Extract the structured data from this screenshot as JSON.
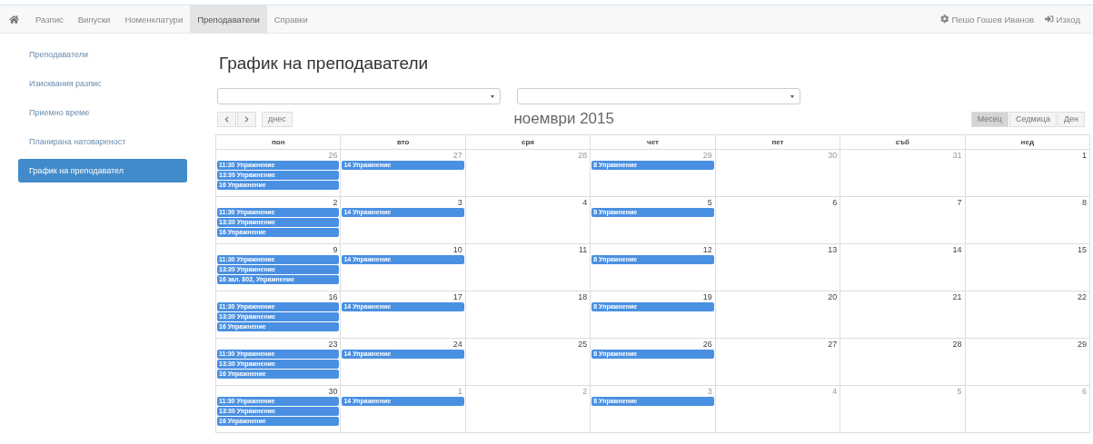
{
  "navbar": {
    "items": [
      {
        "label": "Разпис",
        "selected": false
      },
      {
        "label": "Випуски",
        "selected": false
      },
      {
        "label": "Номенклатури",
        "selected": false
      },
      {
        "label": "Преподаватели",
        "selected": true
      },
      {
        "label": "Справки",
        "selected": false
      }
    ],
    "user": "Пешо Гошев Иванов",
    "logout": "Изход"
  },
  "sidebar": {
    "items": [
      {
        "label": "Преподаватели",
        "selected": false
      },
      {
        "label": "Изисквания разпис",
        "selected": false
      },
      {
        "label": "Приемно време",
        "selected": false
      },
      {
        "label": "Планирана натовареност",
        "selected": false
      },
      {
        "label": "График на преподавател",
        "selected": true
      }
    ]
  },
  "page_title": "График на преподаватели",
  "toolbar": {
    "today": "днес",
    "month_title": "ноември 2015",
    "views": [
      {
        "label": "Месец",
        "selected": true
      },
      {
        "label": "Седмица",
        "selected": false
      },
      {
        "label": "Ден",
        "selected": false
      }
    ]
  },
  "calendar": {
    "weekdays": [
      "пон",
      "вто",
      "сря",
      "чет",
      "пет",
      "съб",
      "нед"
    ],
    "weeks": [
      [
        {
          "day": "26",
          "other_month": true,
          "events": [
            "11:30 Упражнение",
            "13:30 Упражнение",
            "16 Упражнение"
          ]
        },
        {
          "day": "27",
          "other_month": true,
          "events": [
            "14 Упражнение"
          ]
        },
        {
          "day": "28",
          "other_month": true
        },
        {
          "day": "29",
          "other_month": true,
          "events": [
            "8 Упражнение"
          ]
        },
        {
          "day": "30",
          "other_month": true
        },
        {
          "day": "31",
          "other_month": true
        },
        {
          "day": "1",
          "other_month": false
        }
      ],
      [
        {
          "day": "2",
          "other_month": false,
          "events": [
            "11:30 Упражнение",
            "13:30 Упражнение",
            "16 Упражнение"
          ]
        },
        {
          "day": "3",
          "other_month": false,
          "events": [
            "14 Упражнение"
          ]
        },
        {
          "day": "4",
          "other_month": false
        },
        {
          "day": "5",
          "other_month": false,
          "events": [
            "8 Упражнение"
          ]
        },
        {
          "day": "6",
          "other_month": false
        },
        {
          "day": "7",
          "other_month": false
        },
        {
          "day": "8",
          "other_month": false
        }
      ],
      [
        {
          "day": "9",
          "other_month": false,
          "events": [
            "11:30 Упражнение",
            "13:30 Упражнение",
            "16 зал. 802, Упражнение"
          ]
        },
        {
          "day": "10",
          "other_month": false,
          "events": [
            "14 Упражнение"
          ]
        },
        {
          "day": "11",
          "other_month": false
        },
        {
          "day": "12",
          "other_month": false,
          "events": [
            "8 Упражнение"
          ]
        },
        {
          "day": "13",
          "other_month": false
        },
        {
          "day": "14",
          "other_month": false
        },
        {
          "day": "15",
          "other_month": false
        }
      ],
      [
        {
          "day": "16",
          "other_month": false,
          "events": [
            "11:30 Упражнение",
            "13:30 Упражнение",
            "16 Упражнение"
          ]
        },
        {
          "day": "17",
          "other_month": false,
          "events": [
            "14 Упражнение"
          ]
        },
        {
          "day": "18",
          "other_month": false
        },
        {
          "day": "19",
          "other_month": false,
          "events": [
            "8 Упражнение"
          ]
        },
        {
          "day": "20",
          "other_month": false
        },
        {
          "day": "21",
          "other_month": false
        },
        {
          "day": "22",
          "other_month": false
        }
      ],
      [
        {
          "day": "23",
          "other_month": false,
          "events": [
            "11:30 Упражнение",
            "13:30 Упражнение",
            "16 Упражнение"
          ]
        },
        {
          "day": "24",
          "other_month": false,
          "events": [
            "14 Упражнение"
          ]
        },
        {
          "day": "25",
          "other_month": false
        },
        {
          "day": "26",
          "other_month": false,
          "events": [
            "8 Упражнение"
          ]
        },
        {
          "day": "27",
          "other_month": false
        },
        {
          "day": "28",
          "other_month": false
        },
        {
          "day": "29",
          "other_month": false
        }
      ],
      [
        {
          "day": "30",
          "other_month": false,
          "events": [
            "11:30 Упражнение",
            "13:30 Упражнение",
            "16 Упражнение"
          ]
        },
        {
          "day": "1",
          "other_month": true,
          "events": [
            "14 Упражнение"
          ]
        },
        {
          "day": "2",
          "other_month": true
        },
        {
          "day": "3",
          "other_month": true,
          "events": [
            "8 Упражнение"
          ]
        },
        {
          "day": "4",
          "other_month": true
        },
        {
          "day": "5",
          "other_month": true
        },
        {
          "day": "6",
          "other_month": true
        }
      ]
    ]
  }
}
